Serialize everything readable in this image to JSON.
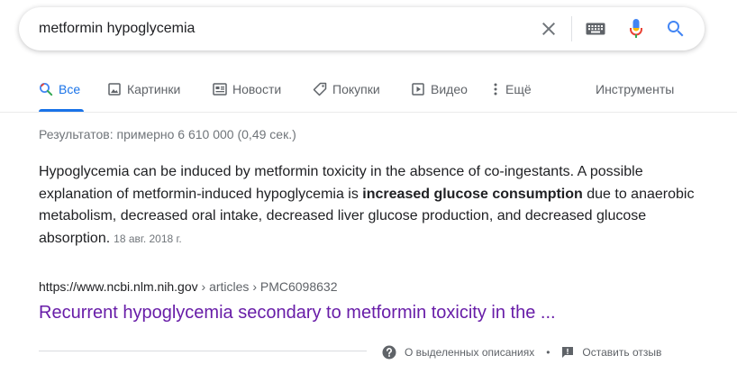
{
  "search": {
    "query": "metformin hypoglycemia",
    "clear_icon": "close-icon",
    "keyboard_icon": "keyboard-icon",
    "mic_icon": "mic-icon",
    "search_icon": "search-icon"
  },
  "tabs": [
    {
      "label": "Все",
      "icon": "search-icon",
      "active": true
    },
    {
      "label": "Картинки",
      "icon": "image-icon"
    },
    {
      "label": "Новости",
      "icon": "news-icon"
    },
    {
      "label": "Покупки",
      "icon": "tag-icon"
    },
    {
      "label": "Видео",
      "icon": "play-icon"
    },
    {
      "label": "Ещё",
      "icon": "more-vert-icon"
    }
  ],
  "tools_label": "Инструменты",
  "stats": "Результатов: примерно 6 610 000 (0,49 сек.)",
  "snippet": {
    "text_before": "Hypoglycemia can be induced by metformin toxicity in the absence of co-ingestants. A possible explanation of metformin-induced hypoglycemia is ",
    "bold": "increased glucose consumption",
    "text_after": " due to anaerobic metabolism, decreased oral intake, decreased liver glucose production, and decreased glucose absorption.",
    "date": "18 авг. 2018 г."
  },
  "result": {
    "url": "https://www.ncbi.nlm.nih.gov",
    "breadcrumbs": " › articles › PMC6098632",
    "title": "Recurrent hypoglycemia secondary to metformin toxicity in the ..."
  },
  "footer": {
    "about_label": "О выделенных описаниях",
    "separator": "•",
    "feedback_label": "Оставить отзыв"
  },
  "colors": {
    "accent": "#1a73e8",
    "visited_link": "#681da8",
    "muted_text": "#70757a"
  }
}
